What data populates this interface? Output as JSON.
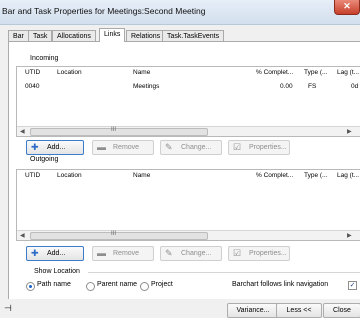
{
  "window": {
    "title": "Bar and Task Properties for Meetings:Second Meeting",
    "close_glyph": "✕"
  },
  "tabs": [
    "Bar",
    "Task",
    "Allocations",
    "Links",
    "Relations",
    "Task.TaskEvents"
  ],
  "incoming": {
    "label": "Incoming",
    "columns": [
      "UTID",
      "Location",
      "Name",
      "% Complet...",
      "Type (...",
      "Lag (t..."
    ],
    "rows": [
      {
        "utid": "0040",
        "location": "",
        "name": "Meetings",
        "complete": "0.00",
        "type": "FS",
        "lag": "0d"
      }
    ]
  },
  "outgoing": {
    "label": "Outgoing",
    "columns": [
      "UTID",
      "Location",
      "Name",
      "% Complet...",
      "Type (...",
      "Lag (t..."
    ],
    "rows": []
  },
  "scroll": {
    "left": "◀",
    "right": "▶",
    "grip": "III"
  },
  "buttons": {
    "add": "Add...",
    "remove": "Remove",
    "change": "Change...",
    "properties": "Properties..."
  },
  "icons": {
    "add": "✚",
    "remove": "▬",
    "change": "✎",
    "properties": "☑"
  },
  "show_location": {
    "label": "Show Location",
    "options": [
      "Path name",
      "Parent name",
      "Project"
    ],
    "selected": "Path name"
  },
  "barchart_nav": {
    "label": "Barchart follows link navigation",
    "checked": true,
    "check_glyph": "✓"
  },
  "footer": {
    "pin_glyph": "⊣",
    "variance": "Variance...",
    "less": "Less <<",
    "close": "Close"
  }
}
